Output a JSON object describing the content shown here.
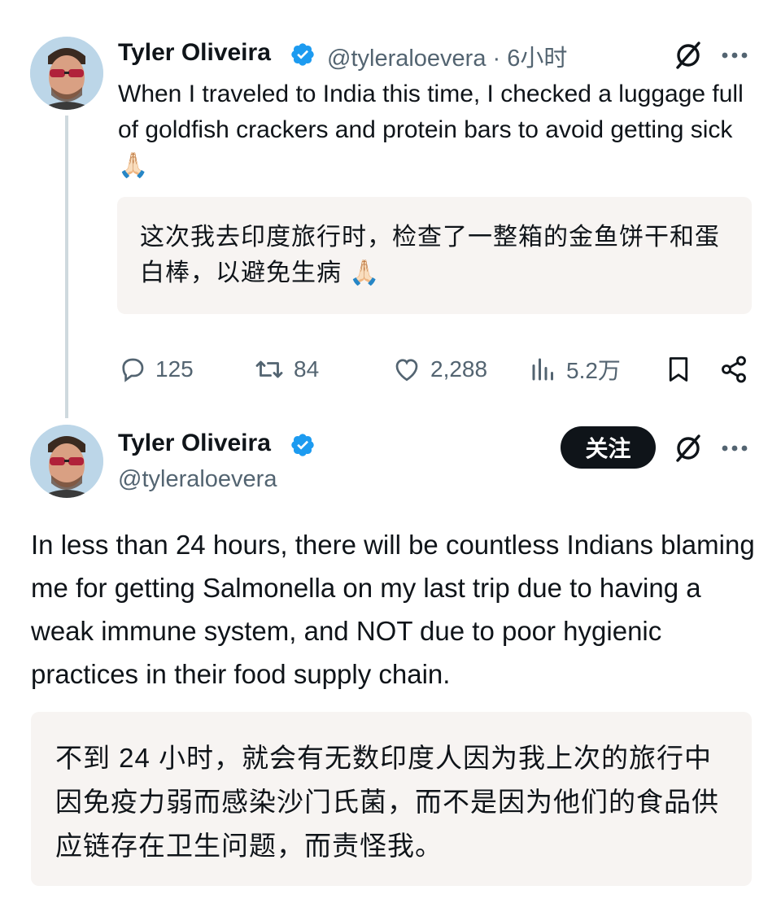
{
  "tweet1": {
    "author_name": "Tyler Oliveira",
    "handle": "@tyleraloevera",
    "separator": "·",
    "time": "6小时",
    "text": "When I traveled to India this time, I checked a luggage full of goldfish crackers and protein bars to avoid getting sick 🙏🏻",
    "translation": "这次我去印度旅行时，检查了一整箱的金鱼饼干和蛋白棒，以避免生病 🙏🏻",
    "stats": {
      "replies": "125",
      "reposts": "84",
      "likes": "2,288",
      "views": "5.2万"
    }
  },
  "tweet2": {
    "author_name": "Tyler Oliveira",
    "handle": "@tyleraloevera",
    "follow_label": "关注",
    "text": "In less than 24 hours, there will be countless Indians blaming me for getting Salmonella on my last trip due to having a weak immune system, and NOT due to poor hygienic practices in their food supply chain.",
    "translation": "不到 24 小时，就会有无数印度人因为我上次的旅行中因免疫力弱而感染沙门氏菌，而不是因为他们的食品供应链存在卫生问题，而责怪我。"
  },
  "icons": {
    "verified": "verified-badge-icon",
    "grok": "slashed-circle-icon",
    "more": "more-dots-icon",
    "reply": "reply-bubble-icon",
    "repost": "repost-icon",
    "like": "heart-icon",
    "views": "bar-chart-icon",
    "bookmark": "bookmark-icon",
    "share": "share-icon"
  },
  "colors": {
    "verified_blue": "#1d9bf0",
    "secondary_text": "#536471",
    "translation_bg": "#f7f4f2",
    "follow_button_bg": "#0f1419"
  }
}
